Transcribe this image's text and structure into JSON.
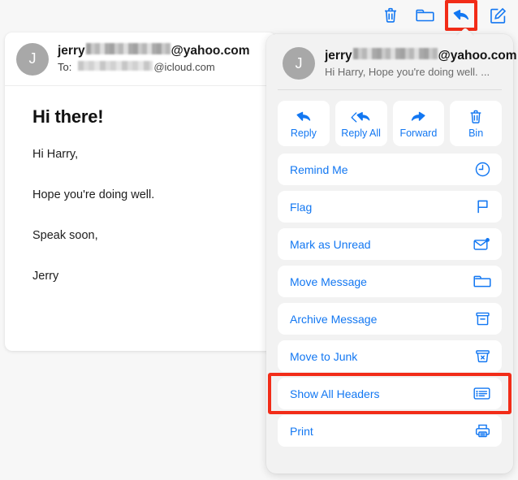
{
  "toolbar": {
    "items": [
      {
        "name": "delete",
        "icon": "trash-icon",
        "label": "Delete"
      },
      {
        "name": "move",
        "icon": "folder-icon",
        "label": "Move"
      },
      {
        "name": "reply",
        "icon": "reply-icon",
        "label": "Reply",
        "highlighted": true
      },
      {
        "name": "compose",
        "icon": "compose-icon",
        "label": "New Message"
      }
    ],
    "highlight_color": "#f22c18"
  },
  "email": {
    "avatar_initial": "J",
    "from_prefix": "jerry",
    "from_suffix": "@yahoo.com",
    "to_label": "To:",
    "to_suffix": "@icloud.com",
    "subject": "Hi there!",
    "body": [
      "Hi Harry,",
      "Hope you're doing well.",
      "Speak soon,",
      "Jerry"
    ]
  },
  "popover": {
    "avatar_initial": "J",
    "from_prefix": "jerry",
    "from_suffix": "@yahoo.com",
    "preview": "Hi Harry, Hope you're doing well. ...",
    "quick_actions": [
      {
        "label": "Reply",
        "icon": "reply-icon"
      },
      {
        "label": "Reply All",
        "icon": "reply-all-icon"
      },
      {
        "label": "Forward",
        "icon": "forward-icon"
      },
      {
        "label": "Bin",
        "icon": "trash-icon"
      }
    ],
    "menu_items": [
      {
        "label": "Remind Me",
        "icon": "clock-icon",
        "highlighted": false
      },
      {
        "label": "Flag",
        "icon": "flag-icon",
        "highlighted": false
      },
      {
        "label": "Mark as Unread",
        "icon": "unread-envelope-icon",
        "highlighted": false
      },
      {
        "label": "Move Message",
        "icon": "folder-icon",
        "highlighted": false
      },
      {
        "label": "Archive Message",
        "icon": "archive-icon",
        "highlighted": false
      },
      {
        "label": "Move to Junk",
        "icon": "junk-icon",
        "highlighted": false
      },
      {
        "label": "Show All Headers",
        "icon": "headers-list-icon",
        "highlighted": true
      },
      {
        "label": "Print",
        "icon": "printer-icon",
        "highlighted": false
      }
    ],
    "accent_color": "#1277f2",
    "highlight_color": "#f22c18"
  }
}
